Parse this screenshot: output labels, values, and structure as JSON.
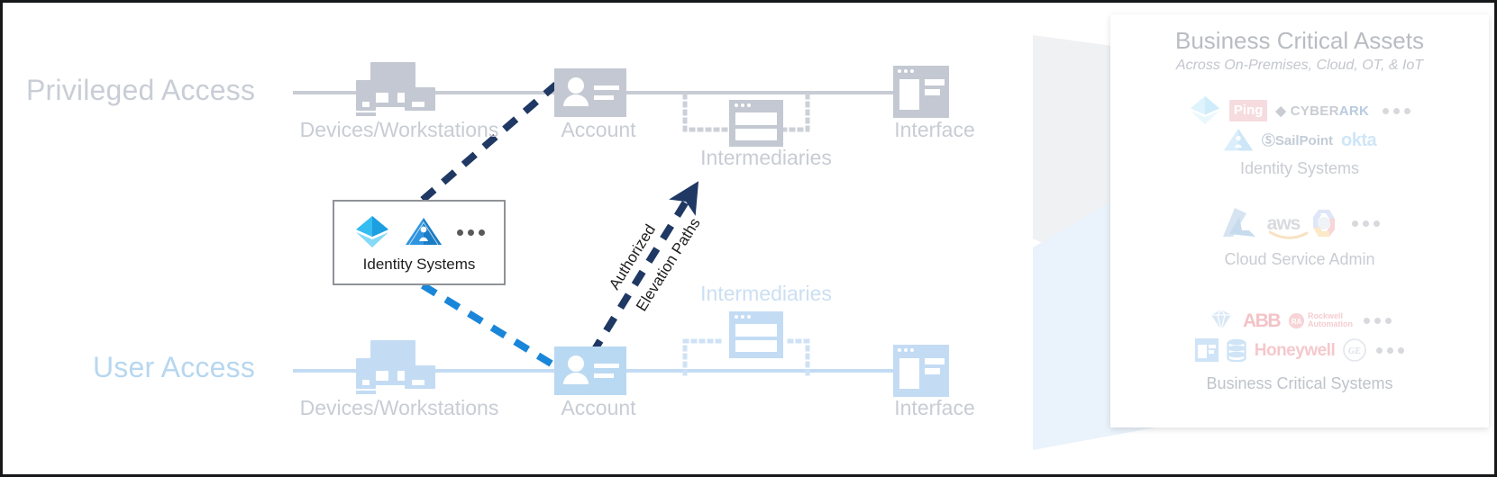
{
  "diagram": {
    "title": "Privileged Access / User Access pathway diagram",
    "colors": {
      "privileged_gray": "#c8ccd4",
      "user_blue": "#bfdcf4",
      "elevation_navy": "#1f3864",
      "elevation_blue": "#1a86d9",
      "panel_text": "#b9bcc2"
    }
  },
  "rows": [
    {
      "id": "privileged",
      "title": "Privileged Access",
      "nodes": [
        {
          "key": "devices",
          "label": "Devices/Workstations",
          "icon": "workstation-icon"
        },
        {
          "key": "account",
          "label": "Account",
          "icon": "account-card-icon"
        },
        {
          "key": "intermediaries",
          "label": "Intermediaries",
          "icon": "window-stack-icon"
        },
        {
          "key": "interface",
          "label": "Interface",
          "icon": "browser-window-icon"
        }
      ]
    },
    {
      "id": "user",
      "title": "User Access",
      "nodes": [
        {
          "key": "devices",
          "label": "Devices/Workstations",
          "icon": "workstation-icon"
        },
        {
          "key": "account",
          "label": "Account",
          "icon": "account-card-icon"
        },
        {
          "key": "intermediaries",
          "label": "Intermediaries",
          "icon": "window-stack-icon"
        },
        {
          "key": "interface",
          "label": "Interface",
          "icon": "browser-window-icon"
        }
      ]
    }
  ],
  "identity_callout": {
    "caption": "Identity Systems",
    "icons": [
      "azure-ad-diamond-icon",
      "active-directory-pyramid-icon",
      "more-dots-icon"
    ]
  },
  "elevation_path": {
    "line1": "Authorized",
    "line2": "Elevation Paths",
    "style": "dashed-arrow"
  },
  "assets_panel": {
    "title": "Business Critical Assets",
    "subtitle": "Across On-Premises, Cloud, OT, & IoT",
    "groups": [
      {
        "caption": "Identity Systems",
        "rows": [
          [
            "azure-ad-diamond-icon",
            "ping-identity-logo",
            "cyberark-logo"
          ],
          [
            "active-directory-pyramid-icon",
            "sailpoint-logo",
            "okta-logo"
          ]
        ],
        "brands": [
          "Ping",
          "CYBERARK",
          "SailPoint",
          "okta"
        ],
        "more": "more-dots-icon"
      },
      {
        "caption": "Cloud Service Admin",
        "rows": [
          [
            "azure-logo",
            "aws-logo",
            "google-cloud-logo"
          ]
        ],
        "brands": [
          "aws"
        ],
        "more": "more-dots-icon"
      },
      {
        "caption": "Business Critical Systems",
        "rows": [
          [
            "sap-diamond-logo",
            "abb-logo",
            "rockwell-automation-logo"
          ],
          [
            "browser-window-icon",
            "database-icon",
            "honeywell-logo",
            "ge-logo"
          ]
        ],
        "brands": [
          "ABB",
          "Rockwell Automation",
          "Honeywell",
          "GE"
        ],
        "more": "more-dots-icon"
      }
    ]
  }
}
